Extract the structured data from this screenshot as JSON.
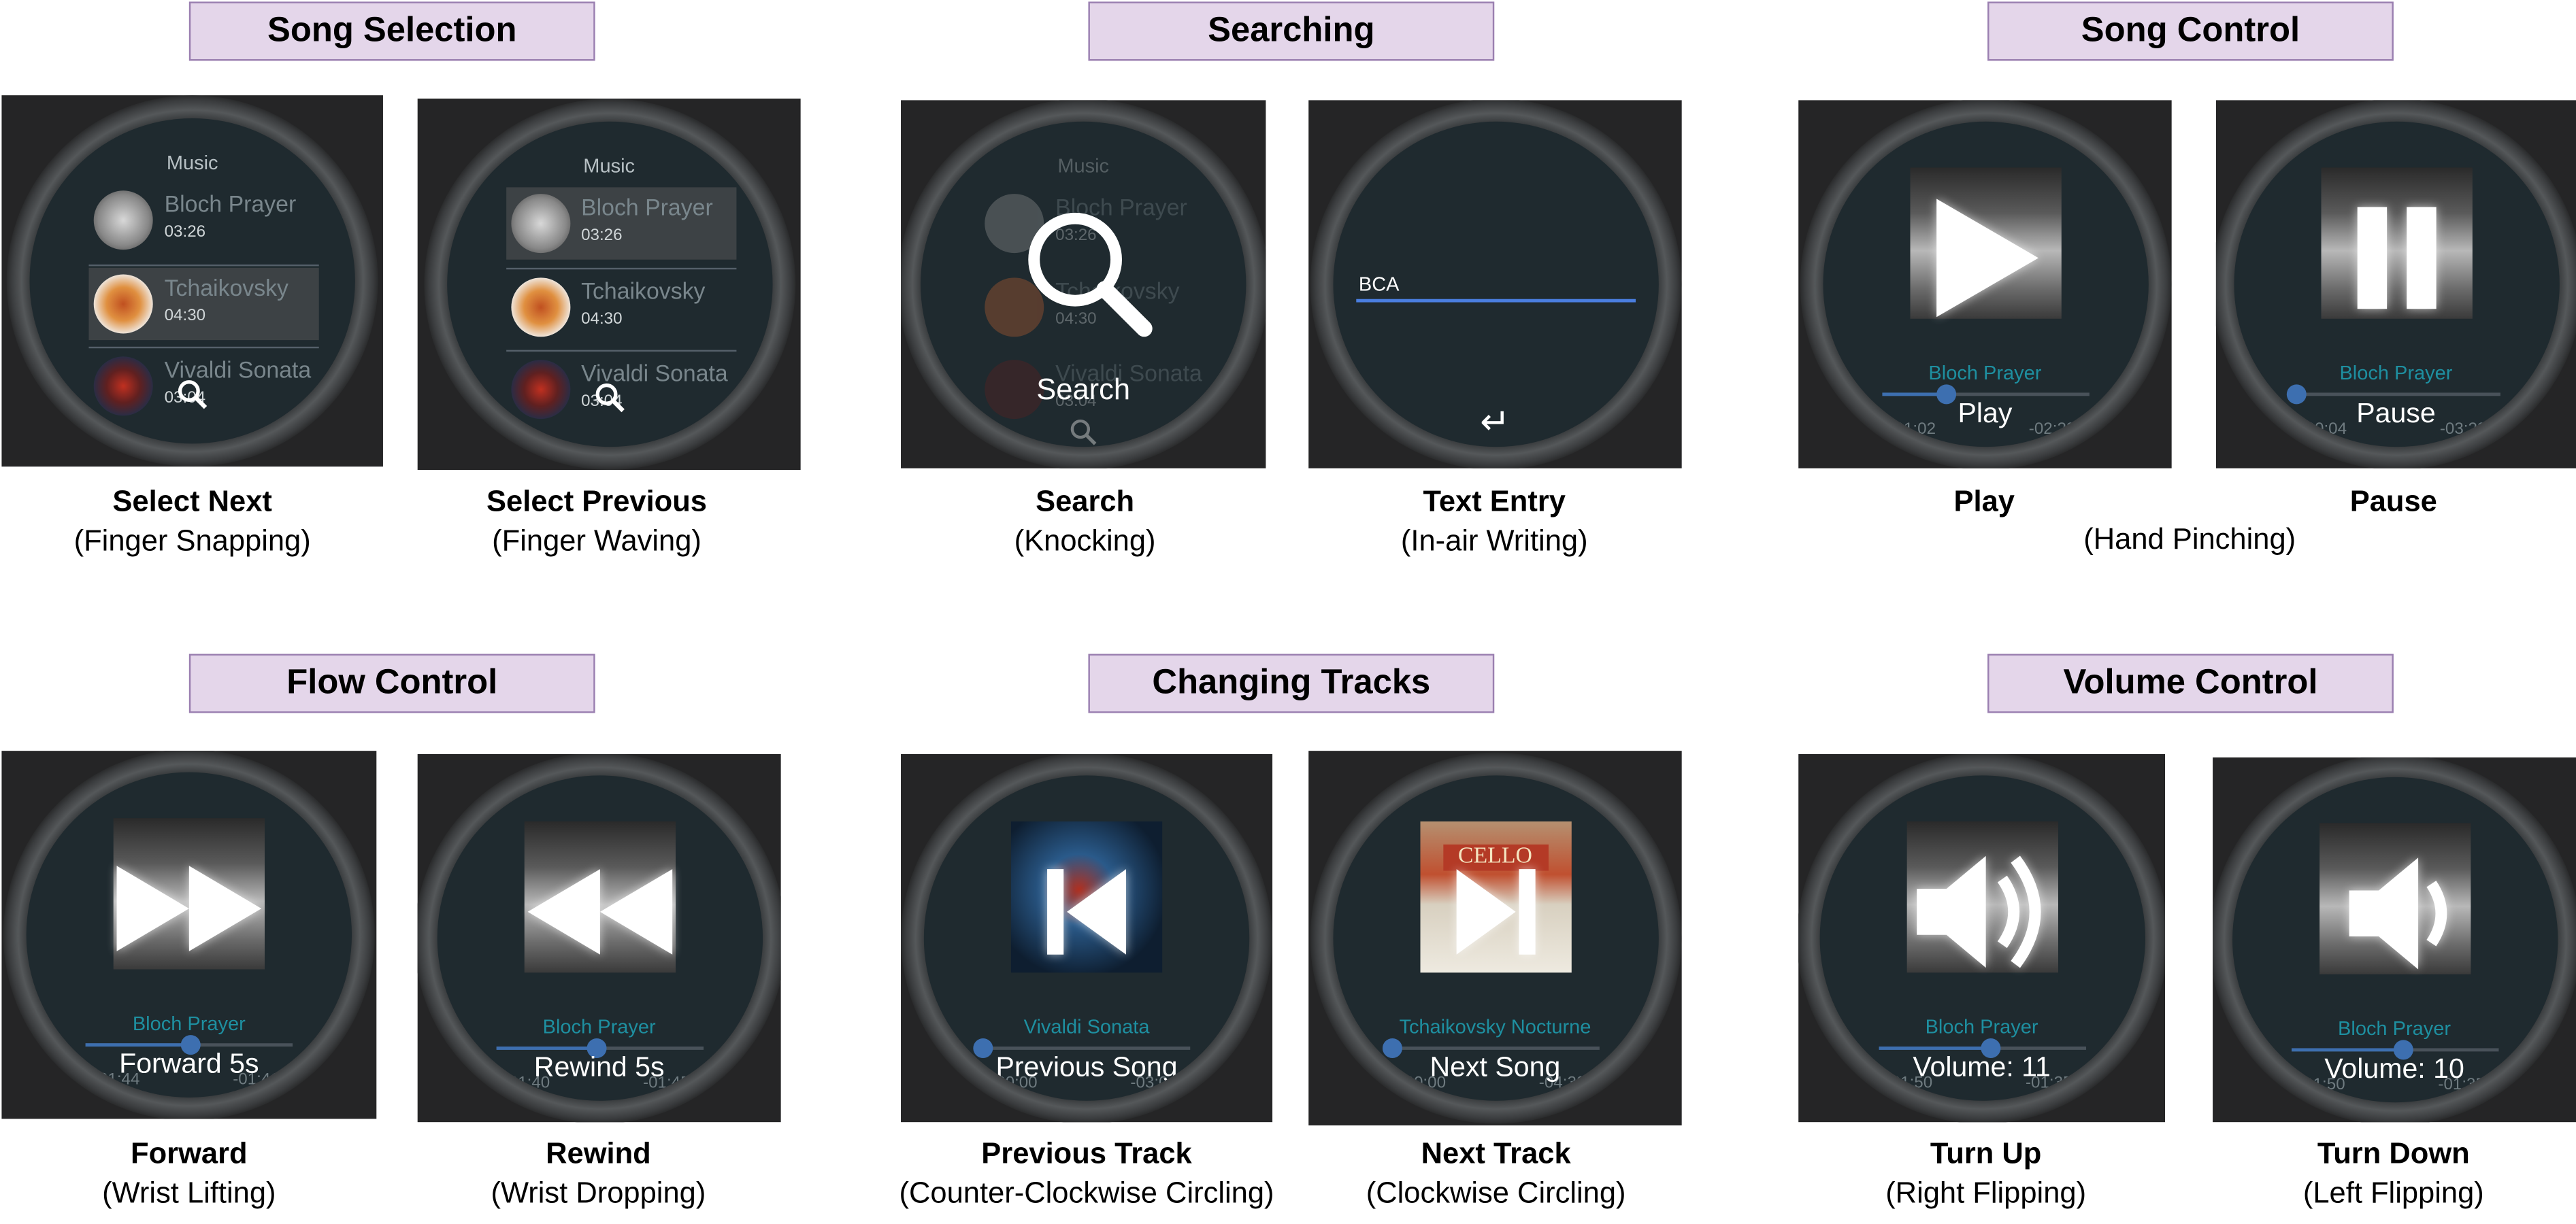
{
  "categories": {
    "song_selection": "Song Selection",
    "searching": "Searching",
    "song_control": "Song Control",
    "flow_control": "Flow Control",
    "changing_tracks": "Changing Tracks",
    "volume_control": "Volume Control"
  },
  "music_list": {
    "title": "Music",
    "songs": [
      {
        "title": "Bloch Prayer",
        "duration": "03:26"
      },
      {
        "title": "Tchaikovsky",
        "duration": "04:30"
      },
      {
        "title": "Vivaldi Sonata",
        "duration": "03:04"
      }
    ]
  },
  "search_screen": {
    "overlay_label": "Search"
  },
  "text_entry_screen": {
    "typed_text": "BCA",
    "enter_symbol": "↵"
  },
  "panels": {
    "select_next": {
      "name": "Select Next",
      "gesture": "(Finger Snapping)"
    },
    "select_previous": {
      "name": "Select Previous",
      "gesture": "(Finger Waving)"
    },
    "search": {
      "name": "Search",
      "gesture": "(Knocking)"
    },
    "text_entry": {
      "name": "Text Entry",
      "gesture": "(In-air Writing)"
    },
    "play": {
      "name": "Play",
      "track": "Bloch Prayer",
      "label": "Play",
      "elapsed": "01:02",
      "remaining": "-02:23",
      "progress": 0.31
    },
    "pause": {
      "name": "Pause",
      "track": "Bloch Prayer",
      "label": "Pause",
      "elapsed": "00:04",
      "remaining": "-03:22",
      "progress": 0.02
    },
    "hand_pinching": "(Hand Pinching)",
    "forward": {
      "name": "Forward",
      "gesture": "(Wrist Lifting)",
      "track": "Bloch Prayer",
      "label": "Forward 5s",
      "elapsed": "01:44",
      "remaining": "-01:41",
      "progress": 0.51
    },
    "rewind": {
      "name": "Rewind",
      "gesture": "(Wrist Dropping)",
      "track": "Bloch Prayer",
      "label": "Rewind 5s",
      "elapsed": "01:40",
      "remaining": "-01:45",
      "progress": 0.49
    },
    "previous_track": {
      "name": "Previous Track",
      "gesture": "(Counter-Clockwise Circling)",
      "track": "Vivaldi Sonata",
      "label": "Previous Song",
      "elapsed": "00:00",
      "remaining": "-03:04",
      "progress": 0.0
    },
    "next_track": {
      "name": "Next Track",
      "gesture": "(Clockwise Circling)",
      "track": "Tchaikovsky Nocturne",
      "label": "Next Song",
      "elapsed": "00:00",
      "remaining": "-04:30",
      "progress": 0.0,
      "album_text": "CELLO"
    },
    "turn_up": {
      "name": "Turn Up",
      "gesture": "(Right Flipping)",
      "track": "Bloch Prayer",
      "label": "Volume: 11",
      "elapsed": "01:50",
      "remaining": "-01:35",
      "progress": 0.54
    },
    "turn_down": {
      "name": "Turn Down",
      "gesture": "(Left Flipping)",
      "track": "Bloch Prayer",
      "label": "Volume: 10",
      "elapsed": "01:50",
      "remaining": "-01:35",
      "progress": 0.54
    }
  },
  "colors": {
    "accent_blue": "#3d6fb0",
    "track_teal": "#1e8fa0",
    "category_fill": "#e4d6ea",
    "category_border": "#9a7fb0"
  }
}
